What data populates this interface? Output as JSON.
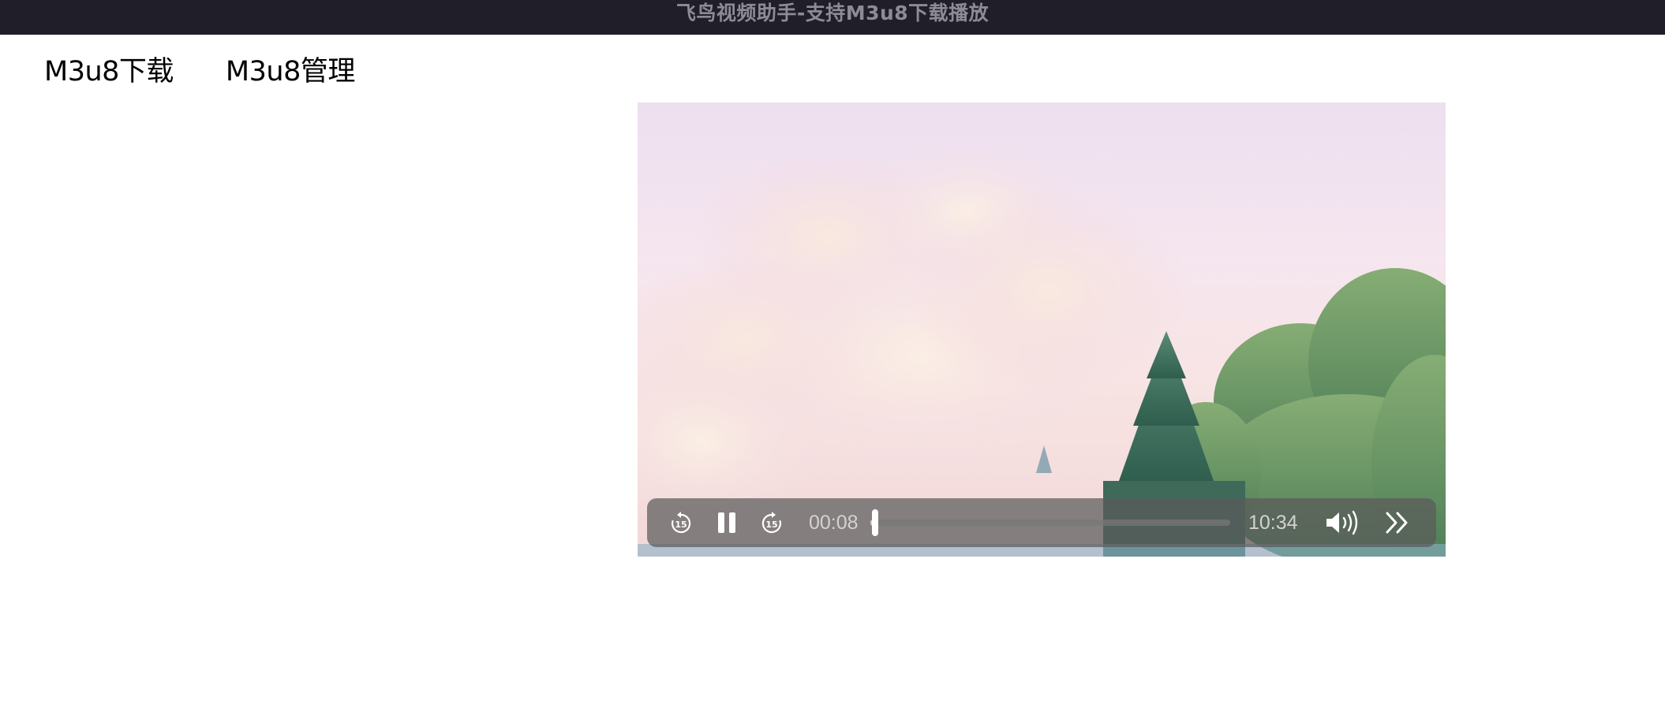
{
  "window": {
    "title": "飞鸟视频助手-支持M3u8下载播放"
  },
  "nav": {
    "tabs": [
      {
        "label": "M3u8下载"
      },
      {
        "label": "M3u8管理"
      }
    ]
  },
  "player": {
    "current_time": "00:08",
    "duration": "10:34",
    "progress": 0.013,
    "skip_seconds_label": "15",
    "icons": {
      "rewind": "rewind-15-icon",
      "pause": "pause-icon",
      "forward": "forward-15-icon",
      "volume": "volume-icon",
      "fast_forward": "fast-forward-icon"
    }
  }
}
